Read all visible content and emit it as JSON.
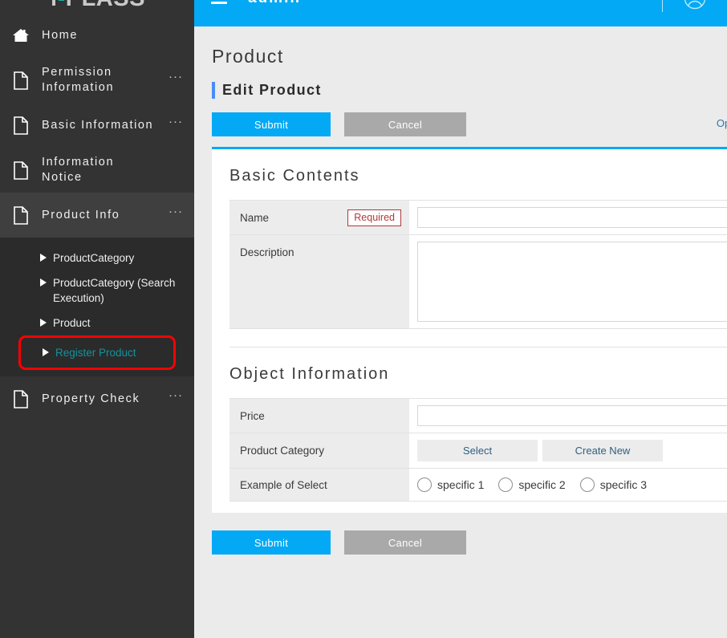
{
  "sidebar": {
    "logo": {
      "prefix": "i",
      "dot": "-",
      "suffix": "PLASS",
      "full": "i-PLASS"
    },
    "items": [
      {
        "label": "Home",
        "icon": "home-icon",
        "ellipsis": "",
        "active": false
      },
      {
        "label": "Permission Information",
        "icon": "document-icon",
        "ellipsis": "···",
        "active": false
      },
      {
        "label": "Basic Information",
        "icon": "document-icon",
        "ellipsis": "···",
        "active": false
      },
      {
        "label": "Information Notice",
        "icon": "document-icon",
        "ellipsis": "",
        "active": false
      },
      {
        "label": "Product Info",
        "icon": "document-icon",
        "ellipsis": "···",
        "active": true
      },
      {
        "label": "Property Check",
        "icon": "document-icon",
        "ellipsis": "···",
        "active": false
      }
    ],
    "submenu": [
      {
        "label": "ProductCategory",
        "highlighted": false
      },
      {
        "label": "ProductCategory (Search Execution)",
        "highlighted": false
      },
      {
        "label": "Product",
        "highlighted": false
      },
      {
        "label": "Register Product",
        "highlighted": true
      }
    ]
  },
  "topbar": {
    "title": "admin     ",
    "menu_icon": "hamburger-icon",
    "user_icon": "user-avatar-icon"
  },
  "page": {
    "title": "Product",
    "section_title": "Edit Product",
    "open_all_label": "Open All"
  },
  "actions": {
    "submit_label": "Submit",
    "cancel_label": "Cancel"
  },
  "basic_contents": {
    "title": "Basic Contents",
    "rows": [
      {
        "label": "Name",
        "required": true,
        "required_label": "Required",
        "type": "text",
        "value": ""
      },
      {
        "label": "Description",
        "required": false,
        "required_label": "",
        "type": "textarea",
        "value": ""
      }
    ]
  },
  "object_information": {
    "title": "Object Information",
    "rows": [
      {
        "label": "Price",
        "type": "text",
        "value": ""
      },
      {
        "label": "Product Category",
        "type": "buttons",
        "buttons": [
          "Select",
          "Create New"
        ]
      },
      {
        "label": "Example of Select",
        "type": "radio",
        "options": [
          "specific 1",
          "specific 2",
          "specific 3"
        ],
        "selected": ""
      }
    ]
  },
  "colors": {
    "accent": "#03a9f4",
    "sidebar_bg": "#333333",
    "sidebar_active": "#3f3f3f",
    "submenu_bg": "#2b2b2b",
    "highlight_border": "#fe0000",
    "highlight_text": "#13929b",
    "page_bg": "#ebebeb",
    "required": "#b03a3a",
    "cancel_bg": "#a9a9a9",
    "section_bar": "#4b8df8",
    "link": "#2f77a8"
  }
}
